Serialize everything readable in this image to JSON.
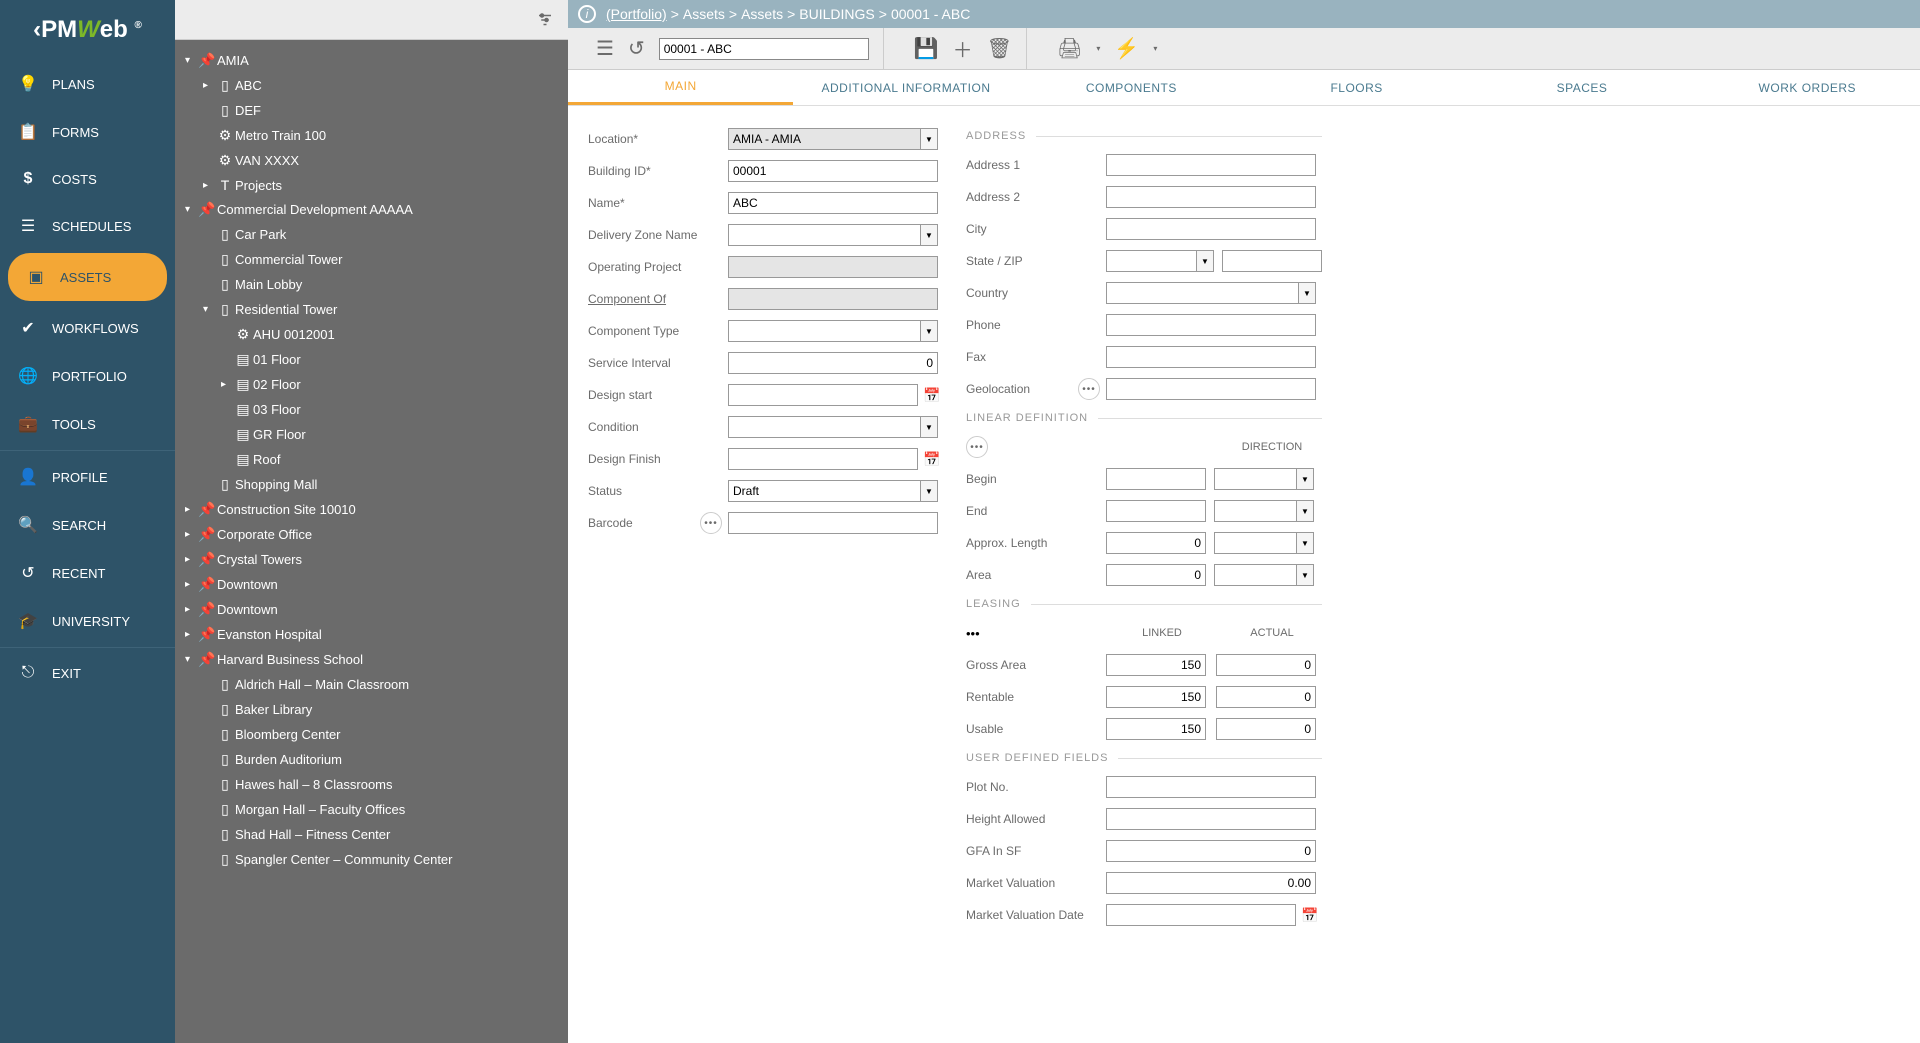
{
  "logo": {
    "pre": "‹PM",
    "w": "W",
    "post": "eb",
    "reg": "®"
  },
  "sidebar": {
    "items": [
      {
        "label": "PLANS"
      },
      {
        "label": "FORMS"
      },
      {
        "label": "COSTS"
      },
      {
        "label": "SCHEDULES"
      },
      {
        "label": "ASSETS"
      },
      {
        "label": "WORKFLOWS"
      },
      {
        "label": "PORTFOLIO"
      },
      {
        "label": "TOOLS"
      },
      {
        "label": "PROFILE"
      },
      {
        "label": "SEARCH"
      },
      {
        "label": "RECENT"
      },
      {
        "label": "UNIVERSITY"
      },
      {
        "label": "EXIT"
      }
    ]
  },
  "breadcrumb": {
    "root": "(Portfolio)",
    "parts": [
      "Assets",
      "Assets",
      "BUILDINGS",
      "00001 - ABC"
    ]
  },
  "record_selector": "00001 - ABC",
  "tree": [
    {
      "d": 0,
      "arrow": "▾",
      "icon": "pin",
      "label": "AMIA"
    },
    {
      "d": 1,
      "arrow": "▸",
      "icon": "doc",
      "label": "ABC"
    },
    {
      "d": 1,
      "arrow": "",
      "icon": "doc",
      "label": "DEF"
    },
    {
      "d": 1,
      "arrow": "",
      "icon": "gear",
      "label": "Metro Train 100"
    },
    {
      "d": 1,
      "arrow": "",
      "icon": "gear",
      "label": "VAN XXXX"
    },
    {
      "d": 1,
      "arrow": "▸",
      "icon": "T",
      "label": "Projects"
    },
    {
      "d": 0,
      "arrow": "▾",
      "icon": "pin",
      "label": "Commercial Development AAAAA"
    },
    {
      "d": 1,
      "arrow": "",
      "icon": "doc",
      "label": "Car Park"
    },
    {
      "d": 1,
      "arrow": "",
      "icon": "doc",
      "label": "Commercial Tower"
    },
    {
      "d": 1,
      "arrow": "",
      "icon": "doc",
      "label": "Main Lobby"
    },
    {
      "d": 1,
      "arrow": "▾",
      "icon": "doc",
      "label": "Residential Tower"
    },
    {
      "d": 2,
      "arrow": "",
      "icon": "gear",
      "label": "AHU 0012001"
    },
    {
      "d": 2,
      "arrow": "",
      "icon": "floor",
      "label": "01 Floor"
    },
    {
      "d": 2,
      "arrow": "▸",
      "icon": "floor",
      "label": "02 Floor"
    },
    {
      "d": 2,
      "arrow": "",
      "icon": "floor",
      "label": "03 Floor"
    },
    {
      "d": 2,
      "arrow": "",
      "icon": "floor",
      "label": "GR Floor"
    },
    {
      "d": 2,
      "arrow": "",
      "icon": "floor",
      "label": "Roof"
    },
    {
      "d": 1,
      "arrow": "",
      "icon": "doc",
      "label": "Shopping Mall"
    },
    {
      "d": 0,
      "arrow": "▸",
      "icon": "pin",
      "label": "Construction Site 10010"
    },
    {
      "d": 0,
      "arrow": "▸",
      "icon": "pin",
      "label": "Corporate Office"
    },
    {
      "d": 0,
      "arrow": "▸",
      "icon": "pin",
      "label": "Crystal Towers"
    },
    {
      "d": 0,
      "arrow": "▸",
      "icon": "pin",
      "label": "Downtown"
    },
    {
      "d": 0,
      "arrow": "▸",
      "icon": "pin",
      "label": "Downtown"
    },
    {
      "d": 0,
      "arrow": "▸",
      "icon": "pin",
      "label": "Evanston Hospital"
    },
    {
      "d": 0,
      "arrow": "▾",
      "icon": "pin",
      "label": "Harvard Business School"
    },
    {
      "d": 1,
      "arrow": "",
      "icon": "doc",
      "label": "Aldrich Hall – Main Classroom"
    },
    {
      "d": 1,
      "arrow": "",
      "icon": "doc",
      "label": "Baker Library"
    },
    {
      "d": 1,
      "arrow": "",
      "icon": "doc",
      "label": "Bloomberg Center"
    },
    {
      "d": 1,
      "arrow": "",
      "icon": "doc",
      "label": "Burden Auditorium"
    },
    {
      "d": 1,
      "arrow": "",
      "icon": "doc",
      "label": "Hawes hall – 8 Classrooms"
    },
    {
      "d": 1,
      "arrow": "",
      "icon": "doc",
      "label": "Morgan Hall – Faculty Offices"
    },
    {
      "d": 1,
      "arrow": "",
      "icon": "doc",
      "label": "Shad Hall – Fitness Center"
    },
    {
      "d": 1,
      "arrow": "",
      "icon": "doc",
      "label": "Spangler Center – Community Center"
    }
  ],
  "tabs": [
    "MAIN",
    "ADDITIONAL INFORMATION",
    "COMPONENTS",
    "FLOORS",
    "SPACES",
    "WORK ORDERS"
  ],
  "form": {
    "left": {
      "location_label": "Location*",
      "location_value": "AMIA - AMIA",
      "building_id_label": "Building ID*",
      "building_id_value": "00001",
      "name_label": "Name*",
      "name_value": "ABC",
      "delivery_zone_label": "Delivery Zone Name",
      "delivery_zone_value": "",
      "operating_project_label": "Operating Project",
      "operating_project_value": "",
      "component_of_label": "Component Of",
      "component_of_value": "",
      "component_type_label": "Component Type",
      "component_type_value": "",
      "service_interval_label": "Service Interval",
      "service_interval_value": "0",
      "design_start_label": "Design start",
      "design_start_value": "",
      "condition_label": "Condition",
      "condition_value": "",
      "design_finish_label": "Design Finish",
      "design_finish_value": "",
      "status_label": "Status",
      "status_value": "Draft",
      "barcode_label": "Barcode",
      "barcode_value": ""
    },
    "right": {
      "address_section": "ADDRESS",
      "address1_label": "Address 1",
      "address1_value": "",
      "address2_label": "Address 2",
      "address2_value": "",
      "city_label": "City",
      "city_value": "",
      "state_zip_label": "State / ZIP",
      "state_value": "",
      "zip_value": "",
      "country_label": "Country",
      "country_value": "",
      "phone_label": "Phone",
      "phone_value": "",
      "fax_label": "Fax",
      "fax_value": "",
      "geolocation_label": "Geolocation",
      "geolocation_value": "",
      "linear_section": "LINEAR DEFINITION",
      "direction_header": "DIRECTION",
      "begin_label": "Begin",
      "begin_value": "",
      "begin_dir": "",
      "end_label": "End",
      "end_value": "",
      "end_dir": "",
      "approx_label": "Approx. Length",
      "approx_value": "0",
      "approx_unit": "",
      "area_label": "Area",
      "area_value": "0",
      "area_unit": "",
      "leasing_section": "LEASING",
      "linked_header": "LINKED",
      "actual_header": "ACTUAL",
      "gross_label": "Gross Area",
      "gross_linked": "150",
      "gross_actual": "0",
      "rentable_label": "Rentable",
      "rentable_linked": "150",
      "rentable_actual": "0",
      "usable_label": "Usable",
      "usable_linked": "150",
      "usable_actual": "0",
      "udf_section": "USER DEFINED FIELDS",
      "plot_label": "Plot No.",
      "plot_value": "",
      "height_label": "Height Allowed",
      "height_value": "",
      "gfa_label": "GFA In SF",
      "gfa_value": "0",
      "mv_label": "Market Valuation",
      "mv_value": "0.00",
      "mvd_label": "Market Valuation Date",
      "mvd_value": ""
    }
  }
}
